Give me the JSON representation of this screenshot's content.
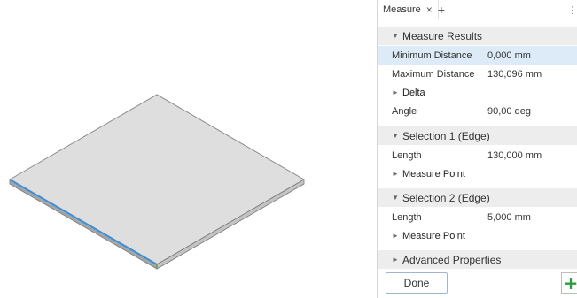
{
  "tab": {
    "label": "Measure",
    "close_glyph": "×",
    "add_glyph": "+",
    "menu_glyph": "⋮"
  },
  "sections": {
    "results": "Measure Results",
    "selection1": "Selection 1 (Edge)",
    "selection2": "Selection 2 (Edge)",
    "advanced": "Advanced Properties"
  },
  "results": {
    "min_label": "Minimum Distance",
    "min_value": "0,000 mm",
    "max_label": "Maximum Distance",
    "max_value": "130,096 mm",
    "delta_label": "Delta",
    "angle_label": "Angle",
    "angle_value": "90,00 deg"
  },
  "selection1": {
    "length_label": "Length",
    "length_value": "130,000 mm",
    "measure_point_label": "Measure Point"
  },
  "selection2": {
    "length_label": "Length",
    "length_value": "5,000 mm",
    "measure_point_label": "Measure Point"
  },
  "footer": {
    "done_label": "Done",
    "add_glyph": "+"
  },
  "icons": {
    "expanded": "▼",
    "collapsed": "►"
  },
  "colors": {
    "selected_edge": "#3d8fd8",
    "highlight_row": "#dcebf7",
    "add_button": "#2e9c3b"
  }
}
